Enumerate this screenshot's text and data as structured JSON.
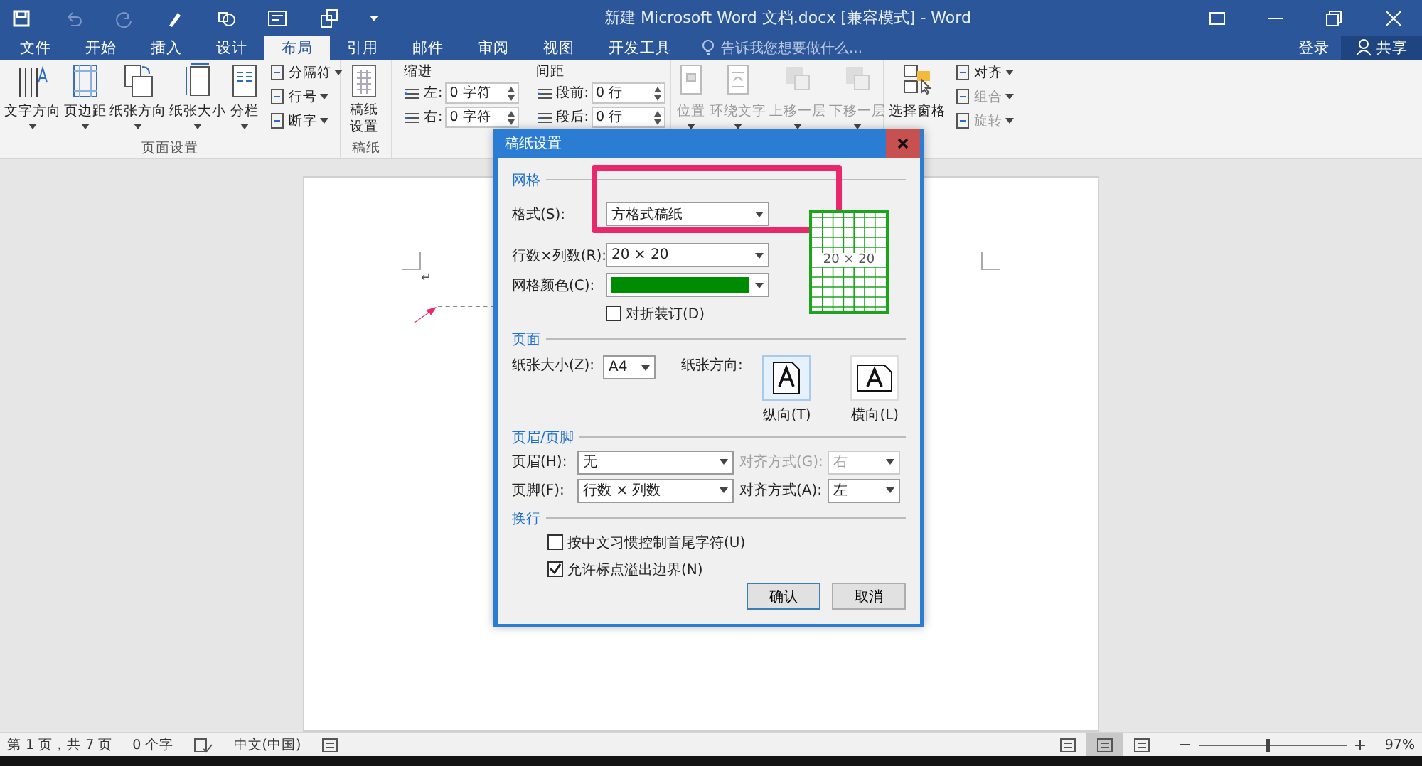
{
  "window": {
    "title": "新建 Microsoft Word 文档.docx [兼容模式] - Word"
  },
  "tabs": [
    {
      "label": "文件",
      "selected": false
    },
    {
      "label": "开始",
      "selected": false
    },
    {
      "label": "插入",
      "selected": false
    },
    {
      "label": "设计",
      "selected": false
    },
    {
      "label": "布局",
      "selected": true
    },
    {
      "label": "引用",
      "selected": false
    },
    {
      "label": "邮件",
      "selected": false
    },
    {
      "label": "审阅",
      "selected": false
    },
    {
      "label": "视图",
      "selected": false
    },
    {
      "label": "开发工具",
      "selected": false
    }
  ],
  "tell_me": {
    "placeholder": "告诉我您想要做什么..."
  },
  "account": {
    "sign_in": "登录",
    "share": "共享"
  },
  "ribbon": {
    "page_setup": {
      "label": "页面设置",
      "large": [
        {
          "label": "文字方向",
          "menu": true
        },
        {
          "label": "页边距",
          "menu": true
        },
        {
          "label": "纸张方向",
          "menu": true
        },
        {
          "label": "纸张大小",
          "menu": true
        },
        {
          "label": "分栏",
          "menu": true
        }
      ],
      "small": [
        {
          "label": "分隔符",
          "menu": true
        },
        {
          "label": "行号",
          "menu": true
        },
        {
          "label": "断字",
          "menu": true
        }
      ]
    },
    "manuscript": {
      "label": "稿纸",
      "button": "稿纸设置"
    },
    "paragraph": {
      "columns": [
        {
          "title": "缩进",
          "fields": [
            {
              "label": "左:",
              "value": "0 字符"
            },
            {
              "label": "右:",
              "value": "0 字符"
            }
          ]
        },
        {
          "title": "间距",
          "fields": [
            {
              "label": "段前:",
              "value": "0 行"
            },
            {
              "label": "段后:",
              "value": "0 行"
            }
          ]
        }
      ]
    },
    "arrange": {
      "large": [
        {
          "label": "位置",
          "disabled": true,
          "menu": true
        },
        {
          "label": "环绕文字",
          "disabled": true,
          "menu": true
        },
        {
          "label": "上移一层",
          "disabled": true,
          "menu": true
        },
        {
          "label": "下移一层",
          "disabled": true,
          "menu": true
        },
        {
          "label": "选择窗格",
          "disabled": false,
          "menu": false
        }
      ],
      "small": [
        {
          "label": "对齐",
          "disabled": false,
          "menu": true
        },
        {
          "label": "组合",
          "disabled": true,
          "menu": true
        },
        {
          "label": "旋转",
          "disabled": true,
          "menu": true
        }
      ]
    }
  },
  "document": {
    "paragraph_mark": "↵"
  },
  "dialog": {
    "title": "稿纸设置",
    "grid": {
      "title": "网格",
      "format": {
        "label": "格式(S):",
        "value": "方格式稿纸"
      },
      "size": {
        "label": "行数×列数(R):",
        "value": "20 × 20"
      },
      "color": {
        "label": "网格颜色(C):",
        "color": "#008c00"
      },
      "fold": {
        "label": "对折装订(D)",
        "checked": false
      },
      "preview": "20 × 20"
    },
    "page": {
      "title": "页面",
      "paper_size": {
        "label": "纸张大小(Z):",
        "value": "A4"
      },
      "orientation": {
        "label": "纸张方向:",
        "options": [
          {
            "label": "纵向(T)",
            "selected": true
          },
          {
            "label": "横向(L)",
            "selected": false
          }
        ]
      }
    },
    "header_footer": {
      "title": "页眉/页脚",
      "rows": [
        {
          "label": "页眉(H):",
          "value": "无",
          "align_label": "对齐方式(G):",
          "align_value": "右",
          "align_disabled": true
        },
        {
          "label": "页脚(F):",
          "value": "行数 × 列数",
          "align_label": "对齐方式(A):",
          "align_value": "左",
          "align_disabled": false
        }
      ]
    },
    "line_break": {
      "title": "换行",
      "options": [
        {
          "label": "按中文习惯控制首尾字符(U)",
          "checked": false
        },
        {
          "label": "允许标点溢出边界(N)",
          "checked": true
        }
      ]
    },
    "buttons": [
      {
        "label": "确认",
        "default": true
      },
      {
        "label": "取消",
        "default": false
      }
    ]
  },
  "status_bar": {
    "page": "第 1 页，共 7 页",
    "words": "0 个字",
    "language": "中文(中国)",
    "views": [
      {
        "selected": false
      },
      {
        "selected": true
      },
      {
        "selected": false
      }
    ],
    "zoom": {
      "level": 0.45,
      "reading": "97%"
    }
  }
}
